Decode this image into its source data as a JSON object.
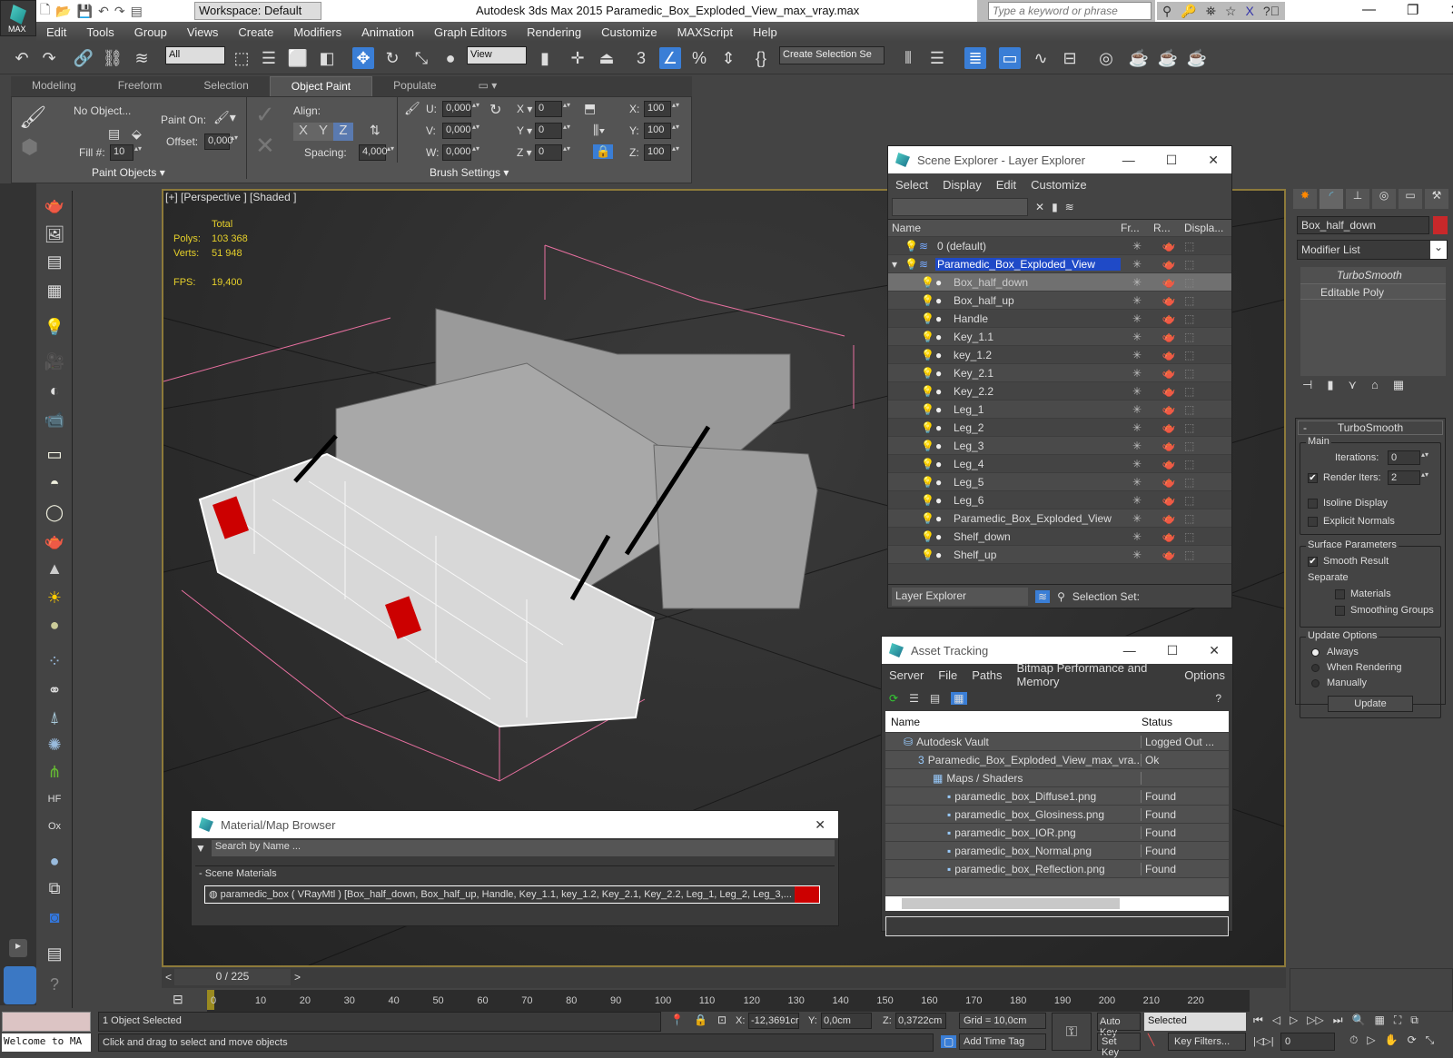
{
  "app": {
    "title": "Autodesk 3ds Max  2015    Paramedic_Box_Exploded_View_max_vray.max",
    "logo_label": "MAX",
    "workspace": "Workspace: Default",
    "search_placeholder": "Type a keyword or phrase"
  },
  "menu": [
    "Edit",
    "Tools",
    "Group",
    "Views",
    "Create",
    "Modifiers",
    "Animation",
    "Graph Editors",
    "Rendering",
    "Customize",
    "MAXScript",
    "Help"
  ],
  "toolbar": {
    "selection_filter": "All",
    "ref_coord": "View",
    "selection_set": "Create Selection Se",
    "snap_label": "3"
  },
  "ribbon": {
    "tabs": [
      "Modeling",
      "Freeform",
      "Selection",
      "Object Paint",
      "Populate"
    ],
    "active_tab": "Object Paint",
    "no_object": "No Object...",
    "paint_on": "Paint On:",
    "fill_label": "Fill #:",
    "fill_value": "10",
    "offset_label": "Offset:",
    "offset_value": "0,000",
    "align_label": "Align:",
    "axes": [
      "X",
      "Y",
      "Z"
    ],
    "spacing_label": "Spacing:",
    "spacing_value": "4,000",
    "u_label": "U:",
    "u_value": "0,000",
    "v_label": "V:",
    "v_value": "0,000",
    "w_label": "W:",
    "w_value": "0,000",
    "rot_x": "0",
    "rot_y": "0",
    "rot_z": "0",
    "scale_x": "100",
    "scale_y": "100",
    "scale_z": "100",
    "group_paint_objects": "Paint Objects",
    "group_brush_settings": "Brush Settings"
  },
  "viewport": {
    "label": "[+] [Perspective ] [Shaded ]",
    "stats_header": "Total",
    "polys_label": "Polys:",
    "polys": "103 368",
    "verts_label": "Verts:",
    "verts": "51 948",
    "fps_label": "FPS:",
    "fps": "19,400"
  },
  "scene_explorer": {
    "title": "Scene Explorer - Layer Explorer",
    "menu": [
      "Select",
      "Display",
      "Edit",
      "Customize"
    ],
    "columns": [
      "Name",
      "Fr...",
      "R...",
      "Displa..."
    ],
    "layers": [
      {
        "name": "0 (default)",
        "level": 0,
        "type": "layer"
      },
      {
        "name": "Paramedic_Box_Exploded_View",
        "level": 0,
        "type": "layer",
        "selected": true
      }
    ],
    "objects": [
      "Box_half_down",
      "Box_half_up",
      "Handle",
      "Key_1.1",
      "key_1.2",
      "Key_2.1",
      "Key_2.2",
      "Leg_1",
      "Leg_2",
      "Leg_3",
      "Leg_4",
      "Leg_5",
      "Leg_6",
      "Paramedic_Box_Exploded_View",
      "Shelf_down",
      "Shelf_up"
    ],
    "highlighted_object": "Box_half_down",
    "footer_mode": "Layer Explorer",
    "selection_set_label": "Selection Set:"
  },
  "asset_tracking": {
    "title": "Asset Tracking",
    "menu": [
      "Server",
      "File",
      "Paths",
      "Bitmap Performance and Memory",
      "Options"
    ],
    "columns": [
      "Name",
      "Status"
    ],
    "rows": [
      {
        "name": "Autodesk Vault",
        "status": "Logged Out ...",
        "indent": 1
      },
      {
        "name": "Paramedic_Box_Exploded_View_max_vra...",
        "status": "Ok",
        "indent": 2
      },
      {
        "name": "Maps / Shaders",
        "status": "",
        "indent": 3
      },
      {
        "name": "paramedic_box_Diffuse1.png",
        "status": "Found",
        "indent": 4
      },
      {
        "name": "paramedic_box_Glosiness.png",
        "status": "Found",
        "indent": 4
      },
      {
        "name": "paramedic_box_IOR.png",
        "status": "Found",
        "indent": 4
      },
      {
        "name": "paramedic_box_Normal.png",
        "status": "Found",
        "indent": 4
      },
      {
        "name": "paramedic_box_Reflection.png",
        "status": "Found",
        "indent": 4
      }
    ]
  },
  "material_browser": {
    "title": "Material/Map Browser",
    "search_placeholder": "Search by Name ...",
    "section": "Scene Materials",
    "material": "paramedic_box  ( VRayMtl )  [Box_half_down, Box_half_up, Handle, Key_1.1, key_1.2, Key_2.1, Key_2.2, Leg_1, Leg_2, Leg_3,..."
  },
  "command_panel": {
    "object_name": "Box_half_down",
    "object_color": "#c8282a",
    "modifier_list": "Modifier List",
    "stack": [
      "TurboSmooth",
      "Editable Poly"
    ],
    "rollout": "TurboSmooth",
    "main_group": "Main",
    "iterations_label": "Iterations:",
    "iterations": "0",
    "render_iters_label": "Render Iters:",
    "render_iters": "2",
    "render_iters_checked": true,
    "isoline": "Isoline Display",
    "isoline_checked": false,
    "explicit_normals": "Explicit Normals",
    "explicit_checked": false,
    "surface_group": "Surface Parameters",
    "smooth_result": "Smooth Result",
    "smooth_checked": true,
    "separate": "Separate",
    "materials": "Materials",
    "smoothing_groups": "Smoothing Groups",
    "update_group": "Update Options",
    "update_options": [
      "Always",
      "When Rendering",
      "Manually"
    ],
    "update_selected": "Always",
    "update_button": "Update"
  },
  "timeline": {
    "frame": "0 / 225",
    "ticks": [
      "0",
      "10",
      "20",
      "30",
      "40",
      "50",
      "60",
      "70",
      "80",
      "90",
      "100",
      "110",
      "120",
      "130",
      "140",
      "150",
      "160",
      "170",
      "180",
      "190",
      "200",
      "210",
      "220"
    ]
  },
  "status": {
    "maxscript": "Welcome to MA",
    "selected": "1 Object Selected",
    "prompt": "Click and drag to select and move objects",
    "x": "-12,3691cr",
    "y": "0,0cm",
    "z": "0,3722cm",
    "grid": "Grid = 10,0cm",
    "add_time_tag": "Add Time Tag",
    "auto_key": "Auto Key",
    "set_key": "Set Key",
    "key_mode": "Selected",
    "key_filters": "Key Filters...",
    "current_frame": "0"
  }
}
